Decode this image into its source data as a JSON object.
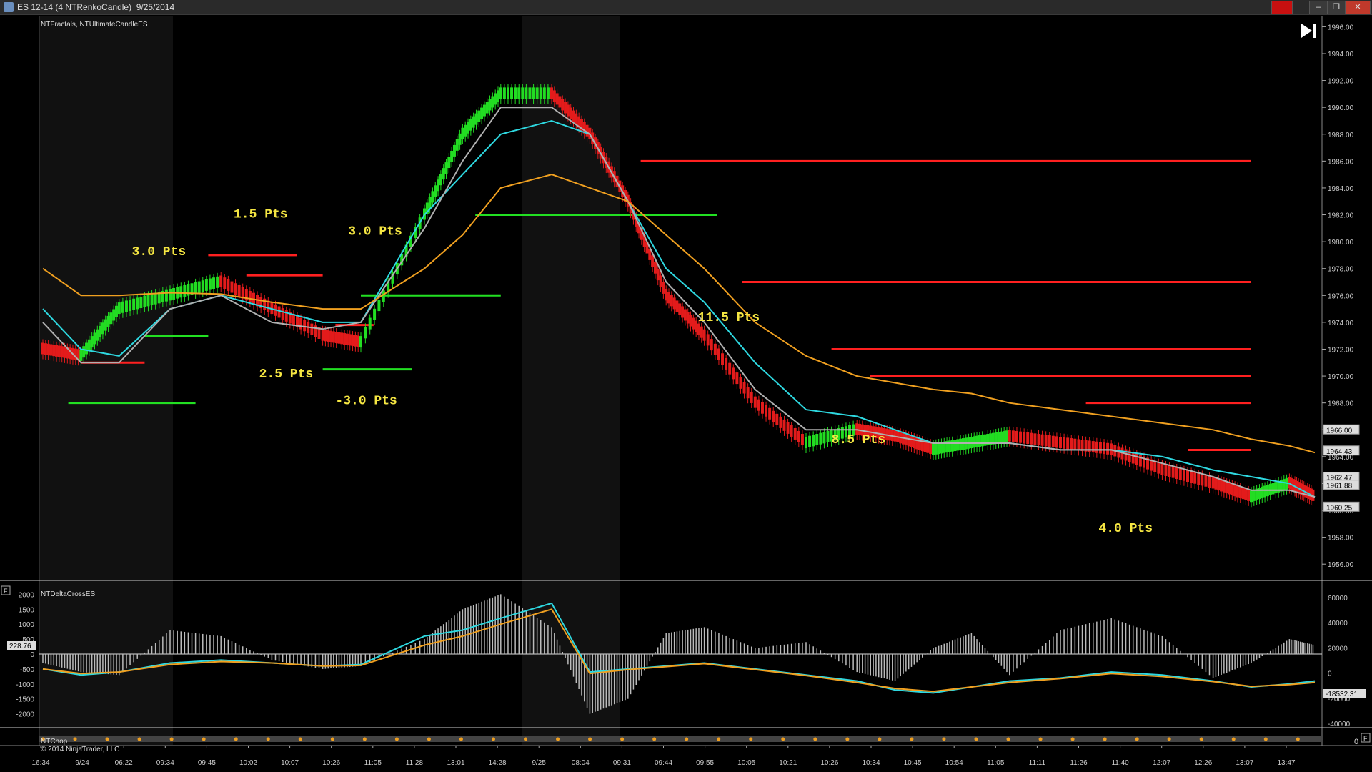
{
  "window": {
    "title": "ES 12-14 (4 NTRenkoCandle)  9/25/2014",
    "buttons": {
      "red": "",
      "minimize": "–",
      "restore": "❐",
      "close": "✕"
    }
  },
  "price_panel": {
    "label": "NTFractals, NTUltimateCandleES",
    "play_icon": "play-skip-icon",
    "y_ticks": [
      "1996.00",
      "1994.00",
      "1992.00",
      "1990.00",
      "1988.00",
      "1986.00",
      "1984.00",
      "1982.00",
      "1980.00",
      "1978.00",
      "1976.00",
      "1974.00",
      "1972.00",
      "1970.00",
      "1968.00",
      "1966.00",
      "1964.00",
      "1962.00",
      "1960.00",
      "1958.00",
      "1956.00"
    ],
    "price_markers": [
      {
        "text": "1966.00",
        "price": 1966.0
      },
      {
        "text": "1964.43",
        "price": 1964.43
      },
      {
        "text": "1962.47",
        "price": 1962.47
      },
      {
        "text": "1961.88",
        "price": 1961.88
      },
      {
        "text": "1960.25",
        "price": 1960.25
      }
    ],
    "annotations": [
      {
        "text": "3.0 Pts",
        "x": 0.07,
        "price": 1979.0
      },
      {
        "text": "1.5 Pts",
        "x": 0.15,
        "price": 1981.8
      },
      {
        "text": "3.0 Pts",
        "x": 0.24,
        "price": 1980.5
      },
      {
        "text": "2.5 Pts",
        "x": 0.17,
        "price": 1969.9
      },
      {
        "text": "-3.0 Pts",
        "x": 0.23,
        "price": 1967.9
      },
      {
        "text": "11.5 Pts",
        "x": 0.515,
        "price": 1974.1
      },
      {
        "text": "8.5 Pts",
        "x": 0.62,
        "price": 1965.0
      },
      {
        "text": "4.0 Pts",
        "x": 0.83,
        "price": 1958.4
      }
    ]
  },
  "delta_panel": {
    "label": "NTDeltaCrossES",
    "f_icon": "F",
    "left_ticks": [
      "2000",
      "1500",
      "1000",
      "500",
      "0",
      "-500",
      "-1000",
      "-1500",
      "-2000"
    ],
    "right_ticks": [
      "60000",
      "40000",
      "20000",
      "0",
      "-20000",
      "-40000"
    ],
    "left_marker": "228.76",
    "right_marker": "-18532.31"
  },
  "chop_panel": {
    "label": "NTChop",
    "copyright": "© 2014 NinjaTrader, LLC",
    "right_tick": "0",
    "f_icon": "F"
  },
  "time_axis": [
    "16:34",
    "9/24",
    "06:22",
    "09:34",
    "09:45",
    "10:02",
    "10:07",
    "10:26",
    "11:05",
    "11:28",
    "13:01",
    "14:28",
    "9/25",
    "08:04",
    "09:31",
    "09:44",
    "09:55",
    "10:05",
    "10:21",
    "10:26",
    "10:34",
    "10:45",
    "10:54",
    "11:05",
    "11:11",
    "11:26",
    "11:40",
    "12:07",
    "12:26",
    "13:07",
    "13:47"
  ],
  "chart_data": {
    "type": "line",
    "title": "",
    "xlabel": "",
    "ylabel": "",
    "ylim": [
      1955.0,
      1996.5
    ],
    "x": [
      0,
      0.03,
      0.06,
      0.1,
      0.14,
      0.18,
      0.22,
      0.25,
      0.3,
      0.33,
      0.36,
      0.4,
      0.43,
      0.46,
      0.49,
      0.52,
      0.56,
      0.6,
      0.64,
      0.67,
      0.7,
      0.73,
      0.76,
      0.8,
      0.84,
      0.88,
      0.92,
      0.95,
      0.98,
      1.0
    ],
    "series": [
      {
        "name": "",
        "color": "#2ed8e0",
        "values": [
          1975,
          1972,
          1971.5,
          1975,
          1976,
          1975,
          1974,
          1974,
          1982,
          1985,
          1988,
          1989,
          1988,
          1983,
          1978,
          1975.5,
          1971,
          1967.5,
          1967,
          1966,
          1965,
          1965,
          1965,
          1964.5,
          1964.5,
          1964,
          1963,
          1962.5,
          1962,
          1961
        ]
      },
      {
        "name": "",
        "color": "#b0b0b0",
        "values": [
          1974,
          1971,
          1971,
          1975,
          1976,
          1974,
          1973.5,
          1974,
          1981,
          1986,
          1990,
          1990,
          1988,
          1983,
          1977,
          1974,
          1969,
          1966,
          1966,
          1965.5,
          1965,
          1965,
          1965,
          1964.5,
          1964.5,
          1963.5,
          1962.5,
          1961.5,
          1961.5,
          1961
        ]
      },
      {
        "name": "",
        "color": "#f0a020",
        "values": [
          1978,
          1976,
          1976,
          1976.2,
          1976.1,
          1975.5,
          1975,
          1975,
          1978,
          1980.5,
          1984,
          1985,
          1984,
          1983,
          1980.5,
          1978,
          1974,
          1971.5,
          1970,
          1969.5,
          1969,
          1968.7,
          1968,
          1967.5,
          1967,
          1966.5,
          1966,
          1965.3,
          1964.8,
          1964.3
        ]
      }
    ],
    "bars": [
      {
        "color": "#e31b1b",
        "values": [
          1972,
          1971.5,
          1975,
          1976,
          1977,
          1975,
          1973,
          1972.5,
          1982,
          1988,
          1991,
          1991,
          1988,
          1983,
          1976,
          1973,
          1968,
          1965,
          1966,
          1965.5,
          1964.5,
          1965,
          1965.5,
          1965,
          1964.5,
          1963,
          1962,
          1961,
          1962,
          1961
        ]
      }
    ],
    "level_lines": [
      {
        "color": "#ff2020",
        "price": 1986.0,
        "x1": 0.47,
        "x2": 0.95
      },
      {
        "color": "#ff2020",
        "price": 1977.0,
        "x1": 0.55,
        "x2": 0.95
      },
      {
        "color": "#ff2020",
        "price": 1972.0,
        "x1": 0.62,
        "x2": 0.95
      },
      {
        "color": "#ff2020",
        "price": 1970.0,
        "x1": 0.65,
        "x2": 0.95
      },
      {
        "color": "#ff2020",
        "price": 1968.0,
        "x1": 0.82,
        "x2": 0.95
      },
      {
        "color": "#ff2020",
        "price": 1964.5,
        "x1": 0.9,
        "x2": 0.95
      },
      {
        "color": "#22e022",
        "price": 1982.0,
        "x1": 0.34,
        "x2": 0.53
      },
      {
        "color": "#22e022",
        "price": 1976.0,
        "x1": 0.25,
        "x2": 0.36
      },
      {
        "color": "#22e022",
        "price": 1970.5,
        "x1": 0.22,
        "x2": 0.29
      },
      {
        "color": "#22e022",
        "price": 1968.0,
        "x1": 0.02,
        "x2": 0.12
      },
      {
        "color": "#22e022",
        "price": 1973.0,
        "x1": 0.08,
        "x2": 0.13
      },
      {
        "color": "#ff2020",
        "price": 1979.0,
        "x1": 0.13,
        "x2": 0.2
      },
      {
        "color": "#ff2020",
        "price": 1977.5,
        "x1": 0.16,
        "x2": 0.22
      },
      {
        "color": "#ff2020",
        "price": 1973.8,
        "x1": 0.23,
        "x2": 0.26
      },
      {
        "color": "#ff2020",
        "price": 1971.0,
        "x1": 0.03,
        "x2": 0.08
      }
    ],
    "delta_histogram": [
      -300,
      -600,
      -700,
      800,
      600,
      -200,
      -500,
      -400,
      500,
      1500,
      2000,
      900,
      -2000,
      -1500,
      700,
      900,
      200,
      400,
      -600,
      -900,
      200,
      700,
      -700,
      800,
      1200,
      600,
      -800,
      -300,
      500,
      300
    ],
    "delta_lines": [
      {
        "name": "",
        "color": "#2ed8e0",
        "values": [
          -500,
          -700,
          -600,
          -300,
          -200,
          -300,
          -400,
          -350,
          600,
          800,
          1200,
          1700,
          -600,
          -500,
          -400,
          -300,
          -500,
          -700,
          -900,
          -1200,
          -1300,
          -1100,
          -900,
          -800,
          -600,
          -700,
          -900,
          -1100,
          -1000,
          -900
        ]
      },
      {
        "name": "",
        "color": "#f0a020",
        "values": [
          -500,
          -650,
          -600,
          -350,
          -250,
          -300,
          -400,
          -380,
          300,
          600,
          1000,
          1500,
          -650,
          -520,
          -420,
          -320,
          -520,
          -720,
          -950,
          -1150,
          -1250,
          -1100,
          -950,
          -820,
          -650,
          -750,
          -920,
          -1080,
          -1020,
          -950
        ]
      }
    ]
  }
}
